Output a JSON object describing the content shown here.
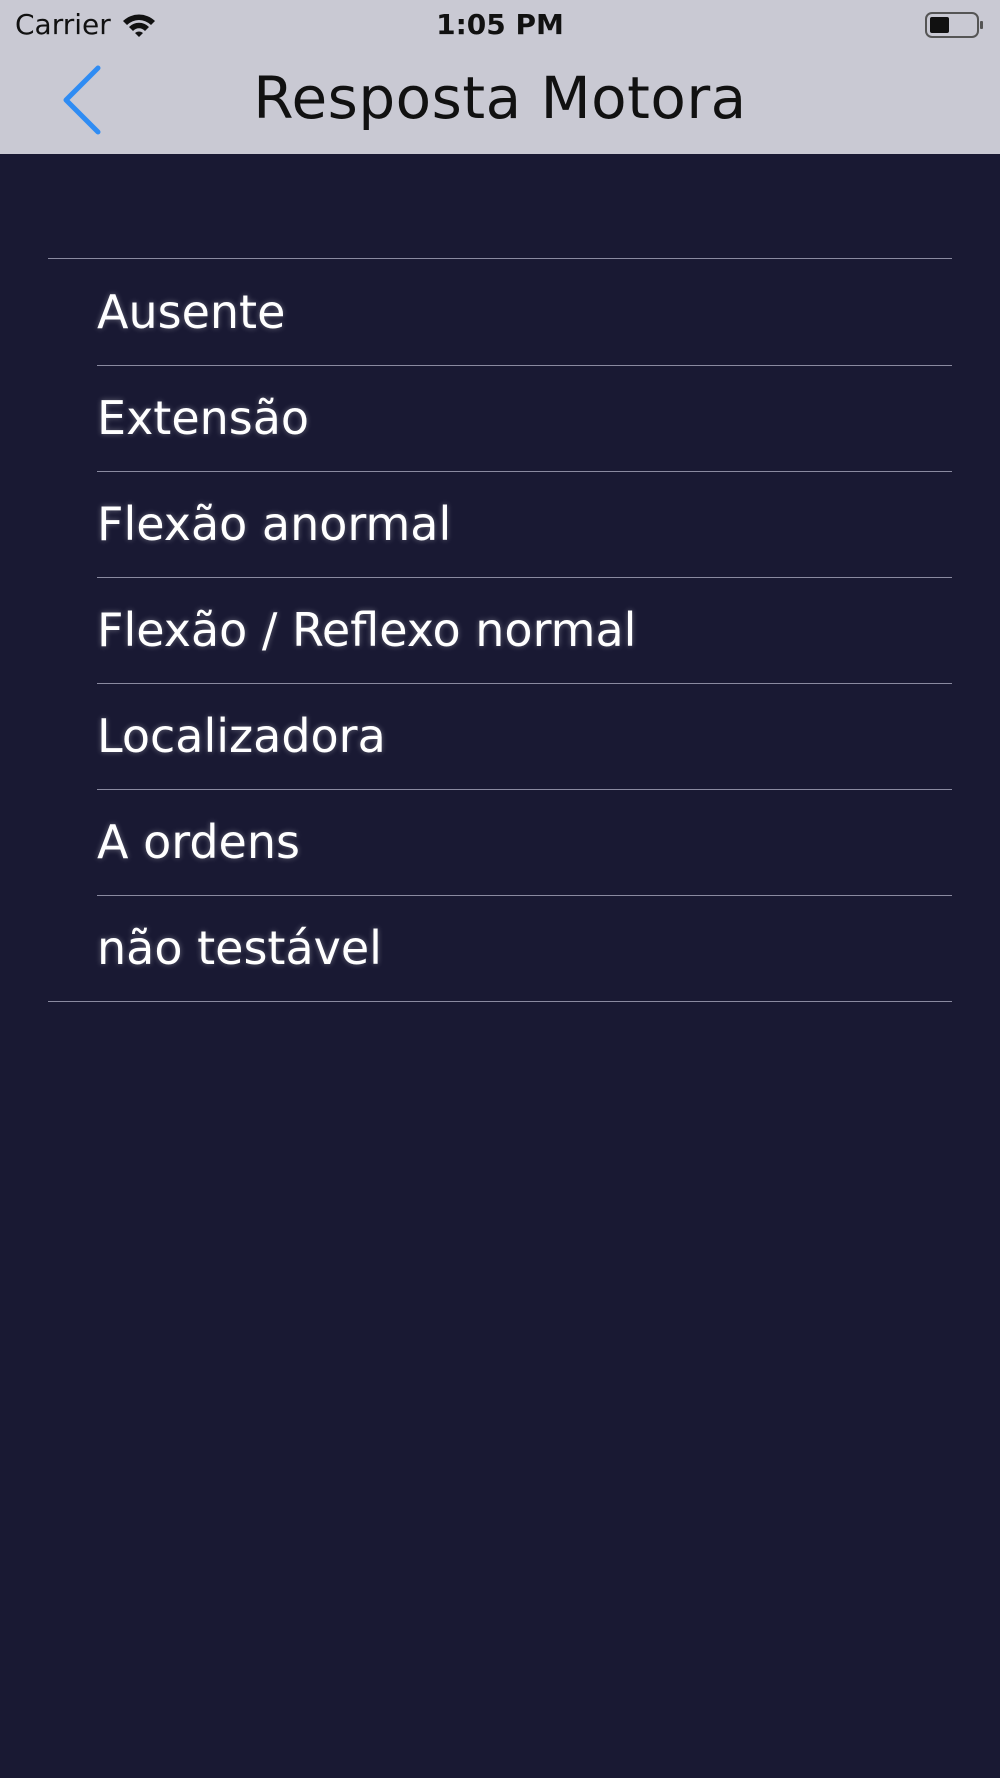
{
  "status_bar": {
    "carrier": "Carrier",
    "time": "1:05 PM",
    "wifi_icon": "wifi-icon",
    "battery_icon": "battery-icon"
  },
  "nav": {
    "title": "Resposta Motora",
    "back_icon": "chevron-left-icon",
    "accent_color": "#2f8cf3"
  },
  "options": [
    {
      "label": "Ausente"
    },
    {
      "label": "Extensão"
    },
    {
      "label": "Flexão anormal"
    },
    {
      "label": "Flexão / Reflexo normal"
    },
    {
      "label": "Localizadora"
    },
    {
      "label": "A ordens"
    },
    {
      "label": "não testável"
    }
  ],
  "colors": {
    "background": "#191933",
    "header": "#c9c9d3",
    "text": "#ffffff",
    "separator": "#8a8aa0"
  }
}
